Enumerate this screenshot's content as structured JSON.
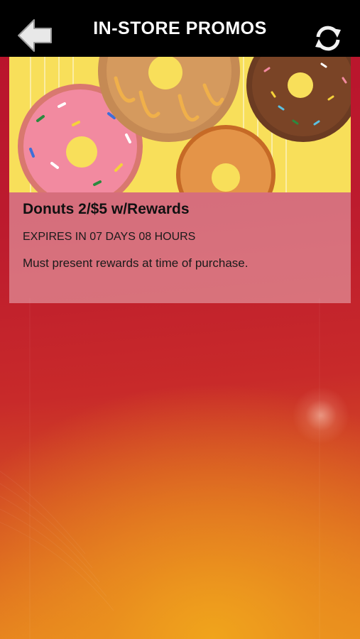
{
  "header": {
    "title": "IN-STORE PROMOS",
    "back_icon": "back-arrow-icon",
    "refresh_icon": "refresh-icon"
  },
  "promos": [
    {
      "title": "Donuts 2/$5 w/Rewards",
      "expiry": "EXPIRES IN 07 DAYS 08 HOURS",
      "description": "Must present rewards at time of purchase."
    }
  ],
  "colors": {
    "header_bg": "#000000",
    "background_top": "#b8122c",
    "background_bottom": "#e98a1e",
    "image_bg": "#f8df5a"
  }
}
